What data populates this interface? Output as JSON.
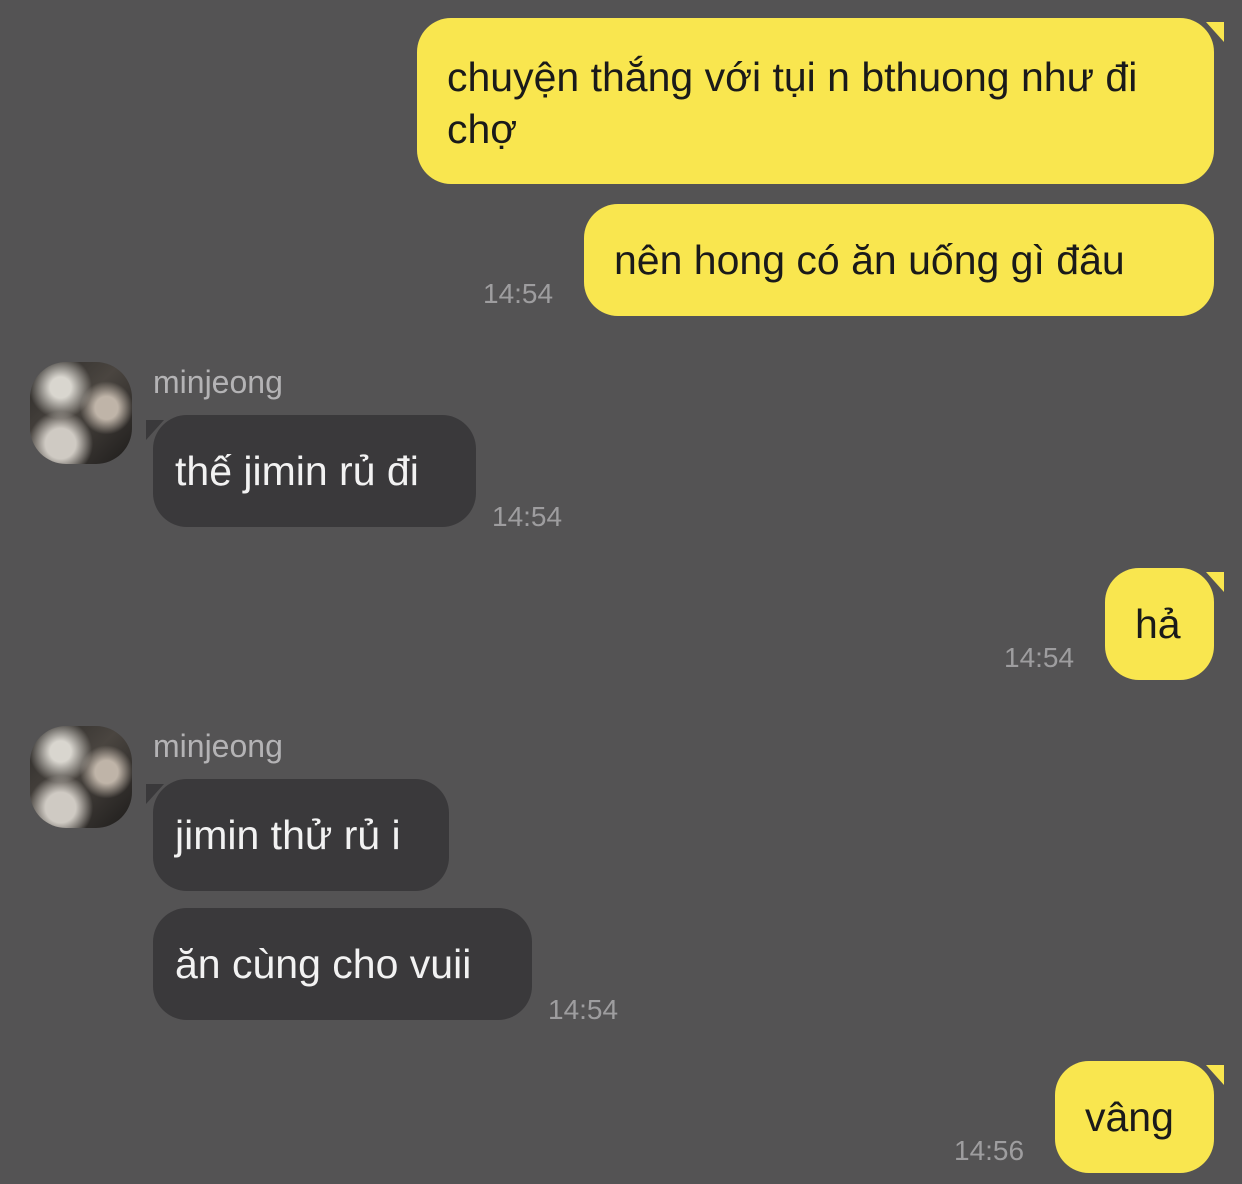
{
  "messages": {
    "m1": {
      "text": "chuyện thắng với tụi n bthuong như đi chợ"
    },
    "m2": {
      "text": "nên hong có ăn uống gì đâu",
      "time": "14:54"
    },
    "m3": {
      "sender": "minjeong",
      "text": "thế jimin rủ đi",
      "time": "14:54"
    },
    "m4": {
      "text": "hả",
      "time": "14:54"
    },
    "m5": {
      "sender": "minjeong",
      "text": "jimin thử rủ i"
    },
    "m6": {
      "text": "ăn cùng cho vuii",
      "time": "14:54"
    },
    "m7": {
      "text": "vâng",
      "time": "14:56"
    }
  },
  "colors": {
    "background": "#545354",
    "outgoing_bubble": "#f9e64f",
    "incoming_bubble": "#3a393b"
  }
}
